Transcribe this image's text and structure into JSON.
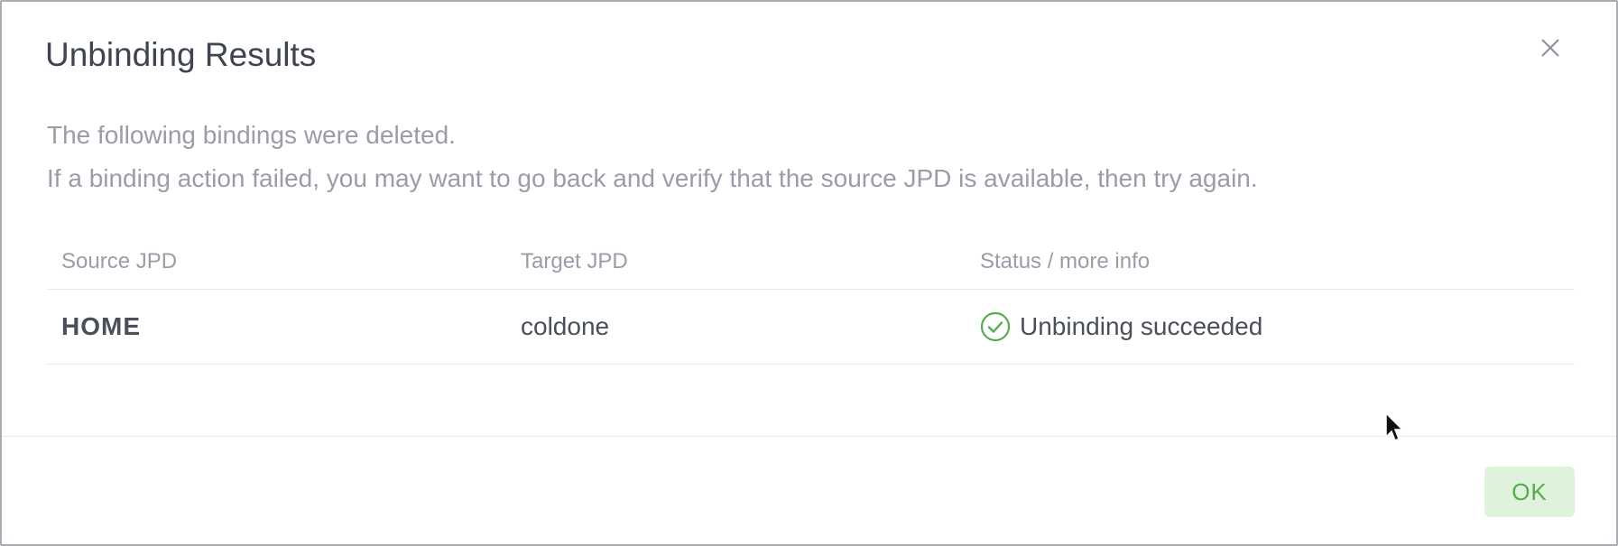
{
  "dialog": {
    "title": "Unbinding Results",
    "close_icon": "close-icon",
    "description_line1": "The following bindings were deleted.",
    "description_line2": "If a binding action failed, you may want to go back and verify that the source JPD is available, then try again."
  },
  "table": {
    "headers": [
      "Source JPD",
      "Target JPD",
      "Status / more info"
    ],
    "rows": [
      {
        "source": "HOME",
        "target": "coldone",
        "status": "Unbinding succeeded",
        "status_icon": "check-circle-icon"
      }
    ]
  },
  "footer": {
    "ok_label": "OK"
  },
  "colors": {
    "success": "#58ac4f",
    "ok_bg": "#dff3dc",
    "title": "#3f4451",
    "muted": "#9a9ca8"
  }
}
